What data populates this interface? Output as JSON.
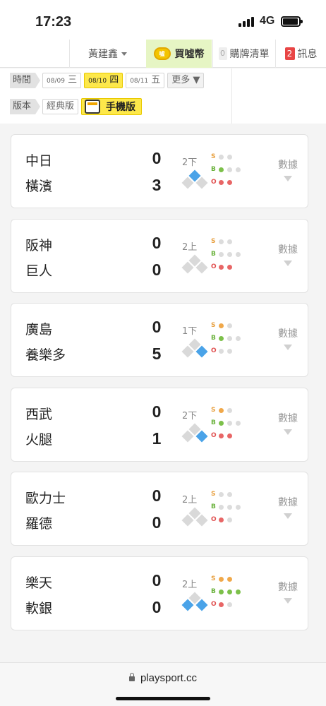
{
  "status_bar": {
    "time": "17:23",
    "network": "4G"
  },
  "nav": {
    "user": "黃建鑫",
    "buy": "買噓幣",
    "coin_text": "噓",
    "cart_count": "0",
    "cart_label": "購牌清單",
    "msg_count": "2",
    "msg_label": "訊息",
    "colors": {
      "buy_bg": "#e6f5c4",
      "badge": "#e84545"
    }
  },
  "filters": {
    "time_label": "時間",
    "dates": [
      {
        "md": "08/09",
        "wd": "三",
        "selected": false
      },
      {
        "md": "08/10",
        "wd": "四",
        "selected": true
      },
      {
        "md": "08/11",
        "wd": "五",
        "selected": false
      }
    ],
    "more": "更多 ▼",
    "version_label": "版本",
    "classic": "經典版",
    "mobile": "手機版",
    "accent": "#fde84a"
  },
  "games": [
    {
      "away": "中日",
      "home": "橫濱",
      "away_score": "0",
      "home_score": "3",
      "inning": "2下",
      "bases": {
        "first": false,
        "second": true,
        "third": false
      },
      "strikes": 0,
      "balls": 1,
      "outs": 2,
      "stats": "數據"
    },
    {
      "away": "阪神",
      "home": "巨人",
      "away_score": "0",
      "home_score": "0",
      "inning": "2上",
      "bases": {
        "first": false,
        "second": false,
        "third": false
      },
      "strikes": 0,
      "balls": 0,
      "outs": 2,
      "stats": "數據"
    },
    {
      "away": "廣島",
      "home": "養樂多",
      "away_score": "0",
      "home_score": "5",
      "inning": "1下",
      "bases": {
        "first": true,
        "second": false,
        "third": false
      },
      "strikes": 1,
      "balls": 1,
      "outs": 0,
      "stats": "數據"
    },
    {
      "away": "西武",
      "home": "火腿",
      "away_score": "0",
      "home_score": "1",
      "inning": "2下",
      "bases": {
        "first": true,
        "second": false,
        "third": false
      },
      "strikes": 1,
      "balls": 1,
      "outs": 2,
      "stats": "數據"
    },
    {
      "away": "歐力士",
      "home": "羅德",
      "away_score": "0",
      "home_score": "0",
      "inning": "2上",
      "bases": {
        "first": false,
        "second": false,
        "third": false
      },
      "strikes": 0,
      "balls": 0,
      "outs": 1,
      "stats": "數據"
    },
    {
      "away": "樂天",
      "home": "軟銀",
      "away_score": "0",
      "home_score": "0",
      "inning": "2上",
      "bases": {
        "first": true,
        "second": false,
        "third": true
      },
      "strikes": 2,
      "balls": 3,
      "outs": 1,
      "stats": "數據"
    }
  ],
  "url": "playsport.cc"
}
